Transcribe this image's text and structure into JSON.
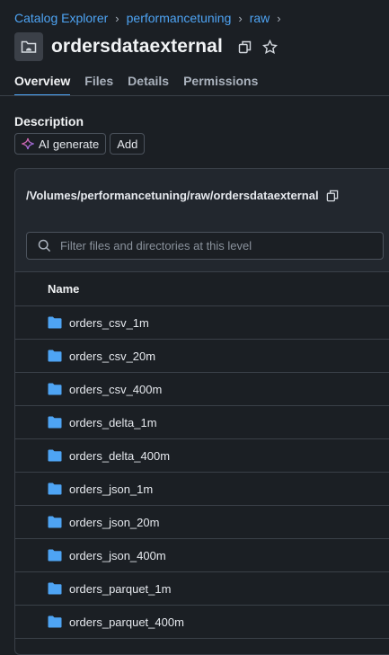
{
  "breadcrumb": {
    "items": [
      "Catalog Explorer",
      "performancetuning",
      "raw"
    ],
    "separator": "›"
  },
  "header": {
    "title": "ordersdataexternal",
    "icon": "volume-icon"
  },
  "tabs": [
    {
      "label": "Overview",
      "active": true
    },
    {
      "label": "Files",
      "active": false
    },
    {
      "label": "Details",
      "active": false
    },
    {
      "label": "Permissions",
      "active": false
    }
  ],
  "description": {
    "label": "Description",
    "ai_generate_label": "AI generate",
    "add_label": "Add"
  },
  "files": {
    "path": "/Volumes/performancetuning/raw/ordersdataexternal",
    "search_placeholder": "Filter files and directories at this level",
    "column_name": "Name",
    "rows": [
      "orders_csv_1m",
      "orders_csv_20m",
      "orders_csv_400m",
      "orders_delta_1m",
      "orders_delta_400m",
      "orders_json_1m",
      "orders_json_20m",
      "orders_json_400m",
      "orders_parquet_1m",
      "orders_parquet_400m"
    ]
  },
  "colors": {
    "accent": "#4ea4f4",
    "folder": "#4ea4f4",
    "background": "#1b1f24"
  }
}
